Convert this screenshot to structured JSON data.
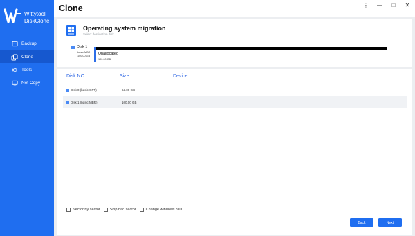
{
  "brand": {
    "line1": "Wittytool",
    "line2": "DiskClone",
    "logo_color": "#ffffff"
  },
  "sidebar": {
    "items": [
      {
        "label": "Backup",
        "icon": "backup-icon"
      },
      {
        "label": "Clone",
        "icon": "clone-icon",
        "active": true
      },
      {
        "label": "Tools",
        "icon": "gear-icon"
      },
      {
        "label": "Net Copy",
        "icon": "net-copy-icon"
      }
    ]
  },
  "header": {
    "title": "Clone"
  },
  "window_controls": {
    "menu": "⋮",
    "minimize": "—",
    "maximize": "□",
    "close": "✕"
  },
  "operation": {
    "title": "Operating system migration",
    "subtitle": "Select destination disk"
  },
  "source_disk": {
    "name": "Disk 1",
    "type": "basic MBR",
    "size": "100.00 GB",
    "partition_label": "Unallocated",
    "partition_size": "100.00 GB"
  },
  "table": {
    "columns": [
      "Disk NO",
      "Size",
      "Device"
    ],
    "rows": [
      {
        "disk": "Disk 0 (basic GPT)",
        "size": "64.00 GB",
        "device": ""
      },
      {
        "disk": "Disk 1 (basic MBR)",
        "size": "100.00 GB",
        "device": "",
        "selected": true
      }
    ]
  },
  "options": [
    {
      "label": "Sector by sector",
      "checked": false
    },
    {
      "label": "Skip bad sector",
      "checked": false
    },
    {
      "label": "Change windows SID",
      "checked": false
    }
  ],
  "buttons": {
    "back": "Back",
    "next": "Next"
  },
  "colors": {
    "accent": "#1f6ef0",
    "sidebar": "#1f6ef0",
    "active_item": "#1658cf",
    "column_header": "#2b64e3"
  }
}
